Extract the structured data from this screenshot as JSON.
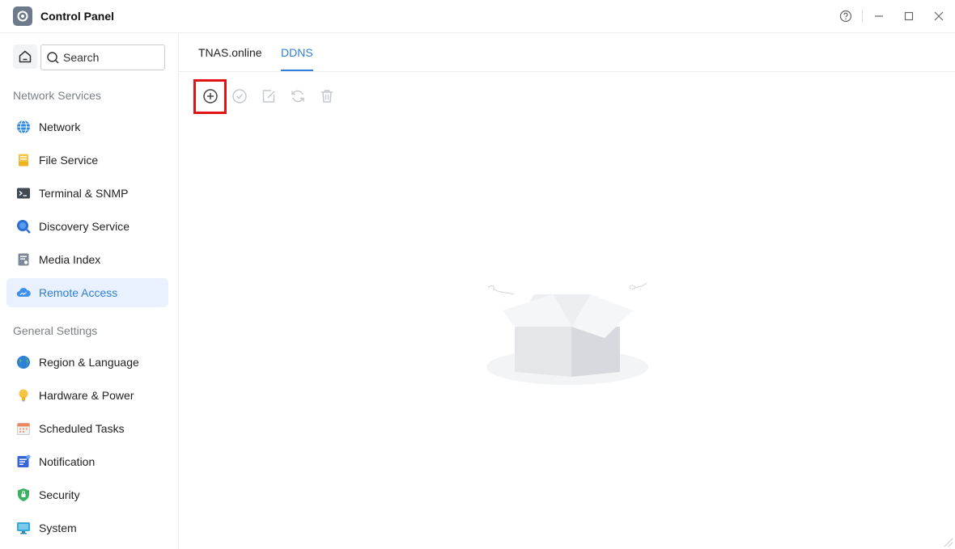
{
  "window": {
    "title": "Control Panel",
    "icons": [
      "settings-gear-icon",
      "help-icon",
      "minimize-icon",
      "maximize-icon",
      "close-icon"
    ]
  },
  "sidebar": {
    "search": {
      "placeholder": "Search",
      "value": ""
    },
    "groups": [
      {
        "label": "Network Services",
        "items": [
          {
            "label": "Network",
            "icon": "globe-icon"
          },
          {
            "label": "File Service",
            "icon": "folder-icon"
          },
          {
            "label": "Terminal & SNMP",
            "icon": "terminal-icon"
          },
          {
            "label": "Discovery Service",
            "icon": "discovery-icon"
          },
          {
            "label": "Media Index",
            "icon": "media-index-icon"
          },
          {
            "label": "Remote Access",
            "icon": "cloud-icon",
            "active": true
          }
        ]
      },
      {
        "label": "General Settings",
        "items": [
          {
            "label": "Region & Language",
            "icon": "region-globe-icon"
          },
          {
            "label": "Hardware & Power",
            "icon": "bulb-icon"
          },
          {
            "label": "Scheduled Tasks",
            "icon": "calendar-icon"
          },
          {
            "label": "Notification",
            "icon": "notification-icon"
          },
          {
            "label": "Security",
            "icon": "shield-icon"
          },
          {
            "label": "System",
            "icon": "monitor-icon"
          }
        ]
      }
    ]
  },
  "main": {
    "tabs": [
      {
        "label": "TNAS.online",
        "active": false
      },
      {
        "label": "DDNS",
        "active": true
      }
    ],
    "toolbar": [
      "add-icon",
      "enable-check-icon",
      "edit-icon",
      "refresh-icon",
      "delete-icon"
    ],
    "empty_state_icon": "empty-box-icon"
  },
  "colors": {
    "accent": "#2f7fd8",
    "active_bg": "#e8f1fd",
    "highlight": "#e41313"
  }
}
